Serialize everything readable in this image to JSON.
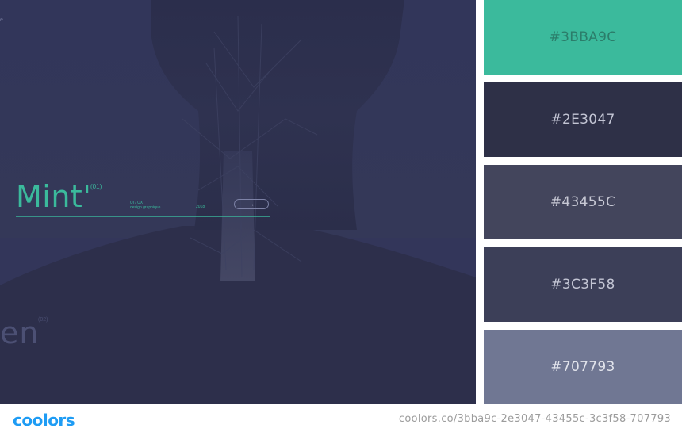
{
  "image": {
    "corner_text": "e",
    "ghost_text": "en",
    "ghost_small": "(02)",
    "card": {
      "title": "Mint'",
      "number": "(01)",
      "meta_line1": "UI / UX",
      "meta_line2": "design graphique",
      "year": "2018",
      "arrow": "→"
    }
  },
  "palette": [
    {
      "hex": "#3BBA9C",
      "color": "#3bba9c",
      "text_color": "#2b7d6a"
    },
    {
      "hex": "#2E3047",
      "color": "#2e3047",
      "text_color": "#c3c5d4"
    },
    {
      "hex": "#43455C",
      "color": "#43455c",
      "text_color": "#c7c8d4"
    },
    {
      "hex": "#3C3F58",
      "color": "#3c3f58",
      "text_color": "#c3c5d4"
    },
    {
      "hex": "#707793",
      "color": "#707793",
      "text_color": "#e2e4ec"
    }
  ],
  "footer": {
    "logo": "coolors",
    "url": "coolors.co/3bba9c-2e3047-43455c-3c3f58-707793"
  }
}
